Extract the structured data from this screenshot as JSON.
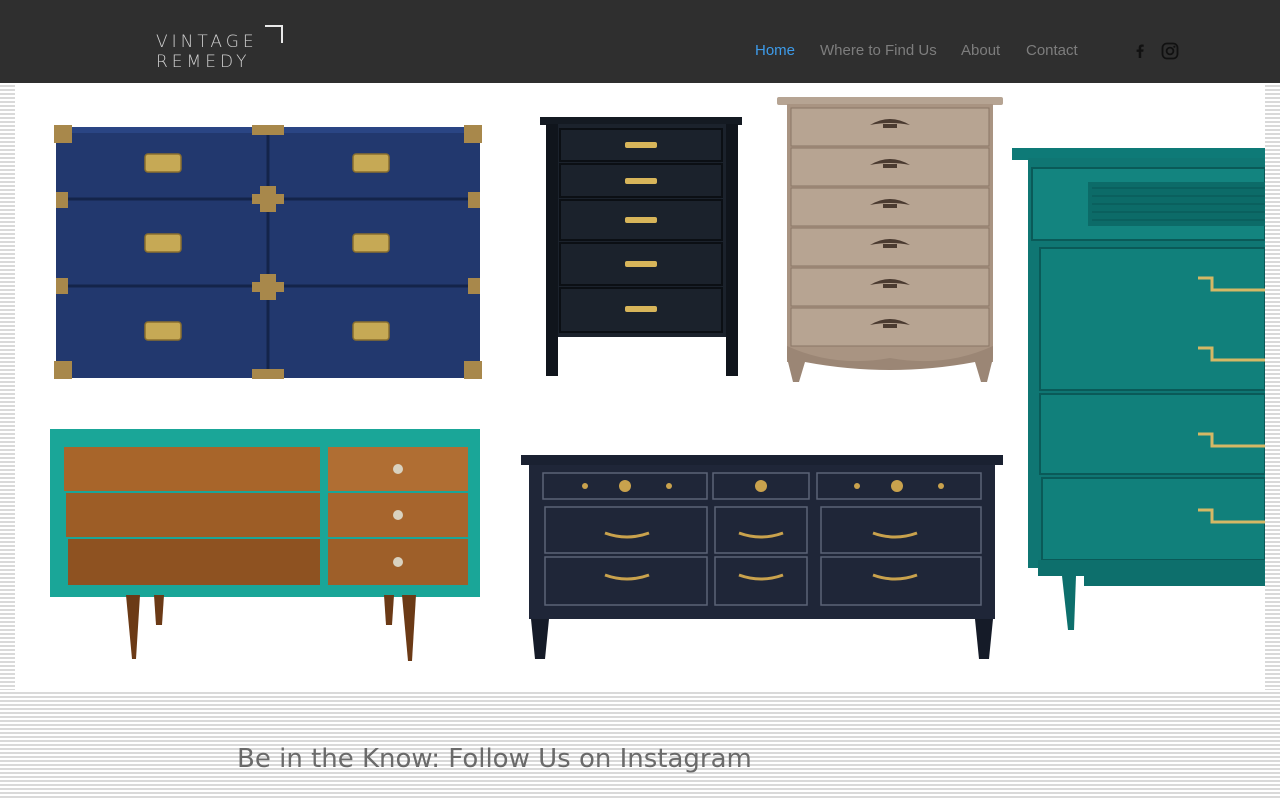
{
  "brand": {
    "line1": "VINTAGE",
    "line2": "REMEDY"
  },
  "nav": [
    {
      "label": "Home",
      "active": true
    },
    {
      "label": "Where to Find Us",
      "active": false
    },
    {
      "label": "About",
      "active": false
    },
    {
      "label": "Contact",
      "active": false
    }
  ],
  "social": [
    {
      "name": "facebook-icon"
    },
    {
      "name": "instagram-icon"
    }
  ],
  "gallery": {
    "items": [
      {
        "name": "navy-campaign-dresser"
      },
      {
        "name": "black-faux-bamboo-chest"
      },
      {
        "name": "taupe-french-provincial-chest"
      },
      {
        "name": "teal-bamboo-tallboy"
      },
      {
        "name": "teal-walnut-mid-century-dresser"
      },
      {
        "name": "navy-lowboy-dresser"
      }
    ]
  },
  "footer": {
    "heading": "Be in the Know: Follow Us on Instagram"
  },
  "colors": {
    "header_bg": "#2f2f2f",
    "nav_active": "#3d9be9",
    "nav_text": "#7d7d7d"
  }
}
